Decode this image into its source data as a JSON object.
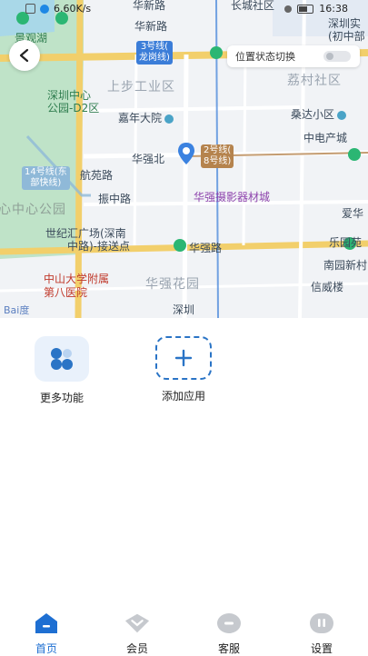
{
  "status_bar": {
    "network_speed": "6.60K/s",
    "time": "16:38"
  },
  "map": {
    "location_toggle_label": "位置状态切换",
    "labels": {
      "huaxin_road_top": "华新路",
      "changcheng_community": "长城社区",
      "shenzhen_shiyan_school": "深圳实",
      "shenzhen_school_line2": "(初中部",
      "jingguan_lake": "景观湖",
      "line3": "3号线(",
      "line3b": "龙岗线)",
      "huaxin_road": "华新路",
      "shangbu_industrial": "上步工业区",
      "lichun_community": "荔村社区",
      "shenzhen_center_park": "深圳中心",
      "shenzhen_center_park2": "公园-D2区",
      "jianian_yard": "嘉年大院",
      "sangda_community": "桑达小区",
      "zhongdian_industry": "中电产城",
      "huaqiang_north": "华强北",
      "line2": "2号线(",
      "line8": "8号线)",
      "line14": "14号线(东",
      "line14b": "部快线)",
      "hangyuan_road": "航苑路",
      "zhenzhong_road": "振中路",
      "huaqiang_photo": "华强摄影器材城",
      "center_park": "心中心公园",
      "ai": "爱华",
      "century_plaza": "世纪汇广场(深南",
      "century_plaza2": "中路)-接送点",
      "huaqiang_road": "华强路",
      "leyuan": "乐园苑",
      "sysu_hospital": "中山大学附属",
      "sysu_hospital2": "第八医院",
      "nanyuan": "南园新村",
      "huaqiang_garden": "华强花园",
      "xinweilou": "信威楼",
      "shenzhen": "深圳",
      "baidu": "Bai度"
    }
  },
  "features": [
    {
      "label": "更多功能",
      "icon": "apps-icon"
    },
    {
      "label": "添加应用",
      "icon": "plus-icon"
    }
  ],
  "nav": [
    {
      "label": "首页",
      "icon": "home-icon",
      "active": true
    },
    {
      "label": "会员",
      "icon": "vip-icon",
      "active": false
    },
    {
      "label": "客服",
      "icon": "service-icon",
      "active": false
    },
    {
      "label": "设置",
      "icon": "settings-icon",
      "active": false
    }
  ],
  "colors": {
    "accent": "#1e6fd2",
    "road_yellow": "#f2cf6b",
    "park_green": "#bfe3c8",
    "metro_green": "#2bb673",
    "metro_brown": "#b5834d",
    "metro_blue": "#3b7dd8"
  }
}
